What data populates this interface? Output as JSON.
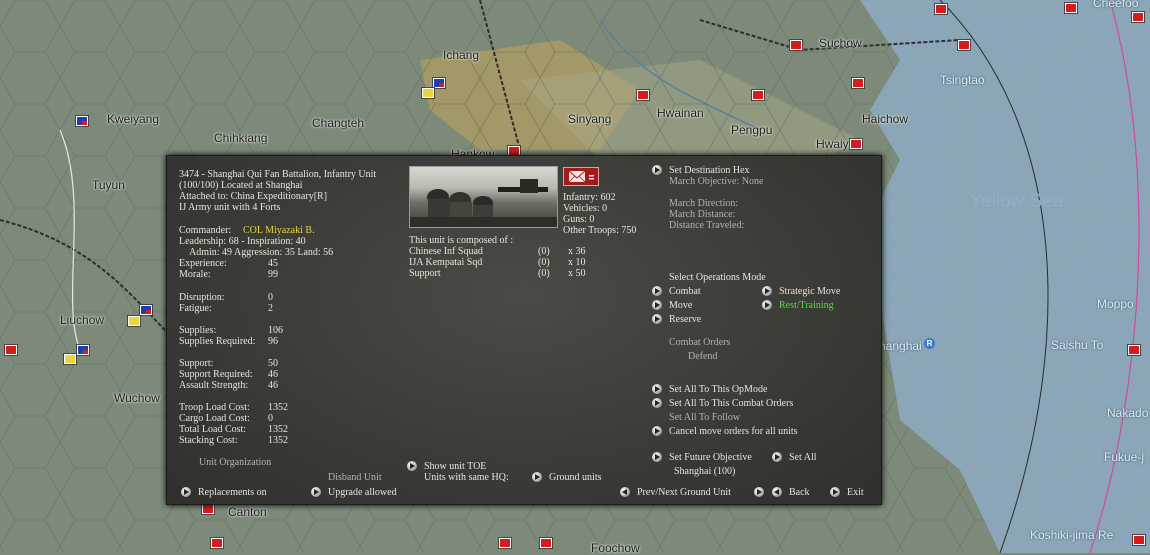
{
  "map": {
    "labels": [
      {
        "text": "Cheefoo",
        "sea": true
      },
      {
        "text": "Suchow"
      },
      {
        "text": "Ichang"
      },
      {
        "text": "Tsingtao",
        "sea": true
      },
      {
        "text": "Kweiyang"
      },
      {
        "text": "Sinyang"
      },
      {
        "text": "Chihkiang"
      },
      {
        "text": "Changteh"
      },
      {
        "text": "Hwainan"
      },
      {
        "text": "Haichow"
      },
      {
        "text": "Pengpu"
      },
      {
        "text": "Hwaiyin"
      },
      {
        "text": "Tuyun"
      },
      {
        "text": "Hankow"
      },
      {
        "text": "Yellow Sea",
        "big": true
      },
      {
        "text": "Moppo",
        "sea": true
      },
      {
        "text": "Liuchow"
      },
      {
        "text": "Shanghai",
        "sea": true
      },
      {
        "text": "Saishu To",
        "sea": true
      },
      {
        "text": "Wuchow"
      },
      {
        "text": "Nakado",
        "sea": true
      },
      {
        "text": "Fukue-j",
        "sea": true
      },
      {
        "text": "Canton"
      },
      {
        "text": "Koshiki-jima Re",
        "sea": true
      },
      {
        "text": "Foochow"
      }
    ],
    "port_marker": "R"
  },
  "unit": {
    "header_lines": [
      "3474 - Shanghai Qui Fan Battalion, Infantry Unit",
      "(100/100) Located at Shanghai",
      "Attached to: China Expeditionary[R]",
      "IJ Army unit with 4 Forts"
    ],
    "commander_label": "Commander:",
    "commander": "COL Miyazaki B.",
    "leader_line1": "Leadership: 68 - Inspiration: 40",
    "leader_line2": "Admin: 49  Aggression: 35 Land: 56",
    "stats": [
      {
        "label": "Experience:",
        "value": "45"
      },
      {
        "label": "Morale:",
        "value": "99"
      },
      {
        "label": "Disruption:",
        "value": "0"
      },
      {
        "label": "Fatigue:",
        "value": "2"
      },
      {
        "label": "Supplies:",
        "value": "106"
      },
      {
        "label": "Supplies Required:",
        "value": "96"
      },
      {
        "label": "Support:",
        "value": "50"
      },
      {
        "label": "Support Required:",
        "value": "46"
      },
      {
        "label": "Assault Strength:",
        "value": "46"
      },
      {
        "label": "Troop Load Cost:",
        "value": "1352"
      },
      {
        "label": "Cargo Load Cost:",
        "value": "0"
      },
      {
        "label": "Total Load Cost:",
        "value": "1352"
      },
      {
        "label": "Stacking Cost:",
        "value": "1352"
      }
    ],
    "strength": [
      "Infantry: 602",
      "Vehicles: 0",
      "Guns: 0",
      "Other Troops: 750"
    ],
    "composed_title": "This unit is composed of :",
    "composition": [
      {
        "name": "Chinese Inf Squad",
        "ready": "(0)",
        "count": "x 36"
      },
      {
        "name": "IJA Kempatai Sqd",
        "ready": "(0)",
        "count": "x 10"
      },
      {
        "name": "Support",
        "ready": "(0)",
        "count": "x 50"
      }
    ]
  },
  "orders": {
    "set_destination": "Set Destination Hex",
    "march_objective": "March Objective: None",
    "march_direction": "March Direction:",
    "march_distance": "March Distance:",
    "distance_traveled": "Distance Traveled:",
    "ops_mode_title": "Select Operations Mode",
    "modes": {
      "combat": "Combat",
      "strategic": "Strategic Move",
      "move": "Move",
      "rest": "Rest/Training",
      "reserve": "Reserve"
    },
    "combat_orders_title": "Combat Orders",
    "combat_orders_value": "Defend",
    "set_all_opmode": "Set All To This OpMode",
    "set_all_combat": "Set All To This Combat Orders",
    "set_all_follow": "Set All To Follow",
    "cancel_move": "Cancel move orders for all units",
    "set_future": "Set Future Objective",
    "set_all": "Set All",
    "future_value": "Shanghai (100)"
  },
  "footer": {
    "unit_org": "Unit Organization",
    "disband": "Disband Unit",
    "show_toe": "Show unit TOE",
    "same_hq": "Units with same HQ:",
    "ground_units": "Ground units",
    "replacements": "Replacements on",
    "upgrade": "Upgrade allowed",
    "prev_next": "Prev/Next Ground Unit",
    "back": "Back",
    "exit": "Exit"
  },
  "colors": {
    "panel_bg": "#3d3d39",
    "text": "#e8e6da",
    "commander": "#e8d640",
    "active_mode": "#48e040",
    "land": "#7d8a79",
    "sea": "#8aa6b8"
  }
}
